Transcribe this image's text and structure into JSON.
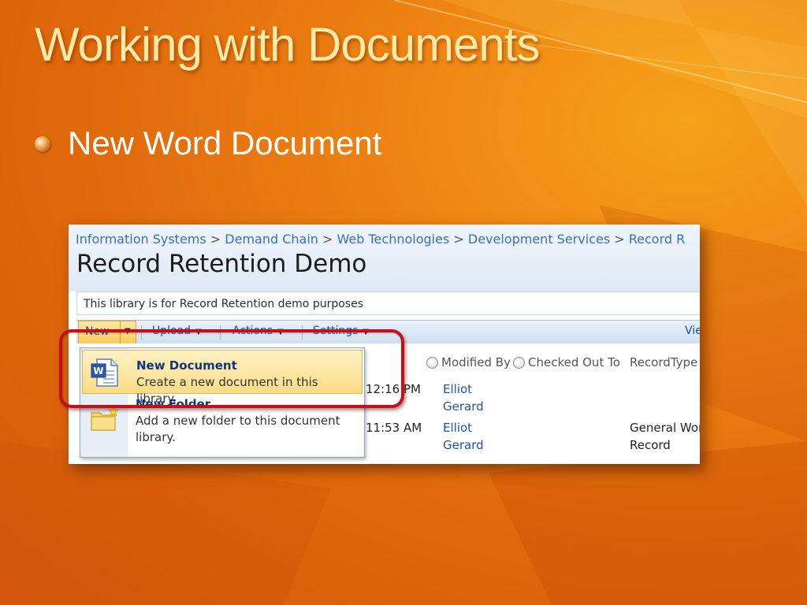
{
  "slide": {
    "title": "Working with Documents",
    "bullet": "New Word Document"
  },
  "sharepoint": {
    "breadcrumb": [
      "Information Systems",
      "Demand Chain",
      "Web Technologies",
      "Development Services",
      "Record R"
    ],
    "breadcrumb_separator": ">",
    "list_title": "Record Retention Demo",
    "description": "This library is for Record Retention demo purposes",
    "toolbar": {
      "new_label": "New",
      "upload_label": "Upload",
      "actions_label": "Actions",
      "settings_label": "Settings",
      "view_label": "Vie"
    },
    "columns": {
      "modified_by": "Modified By",
      "checked_out_to": "Checked Out To",
      "record_type": "RecordType"
    },
    "rows": [
      {
        "time": "12:16 PM",
        "modified_by_first": "Elliot",
        "modified_by_last": "Gerard",
        "record_type_1": "",
        "record_type_2": ""
      },
      {
        "time": "11:53 AM",
        "modified_by_first": "Elliot",
        "modified_by_last": "Gerard",
        "record_type_1": "General Work",
        "record_type_2": "Record"
      }
    ],
    "new_menu": {
      "items": [
        {
          "title": "New Document",
          "description": "Create a new document in this library.",
          "icon": "word-document-icon"
        },
        {
          "title": "New Folder",
          "description_line1": "Add a new folder to this document",
          "description_line2": "library.",
          "icon": "new-folder-icon"
        }
      ]
    }
  },
  "colors": {
    "title": "#fde9a6",
    "highlight_ring": "#c0111b",
    "link": "#1f54a6",
    "menu_hover": "#fbdc86"
  }
}
